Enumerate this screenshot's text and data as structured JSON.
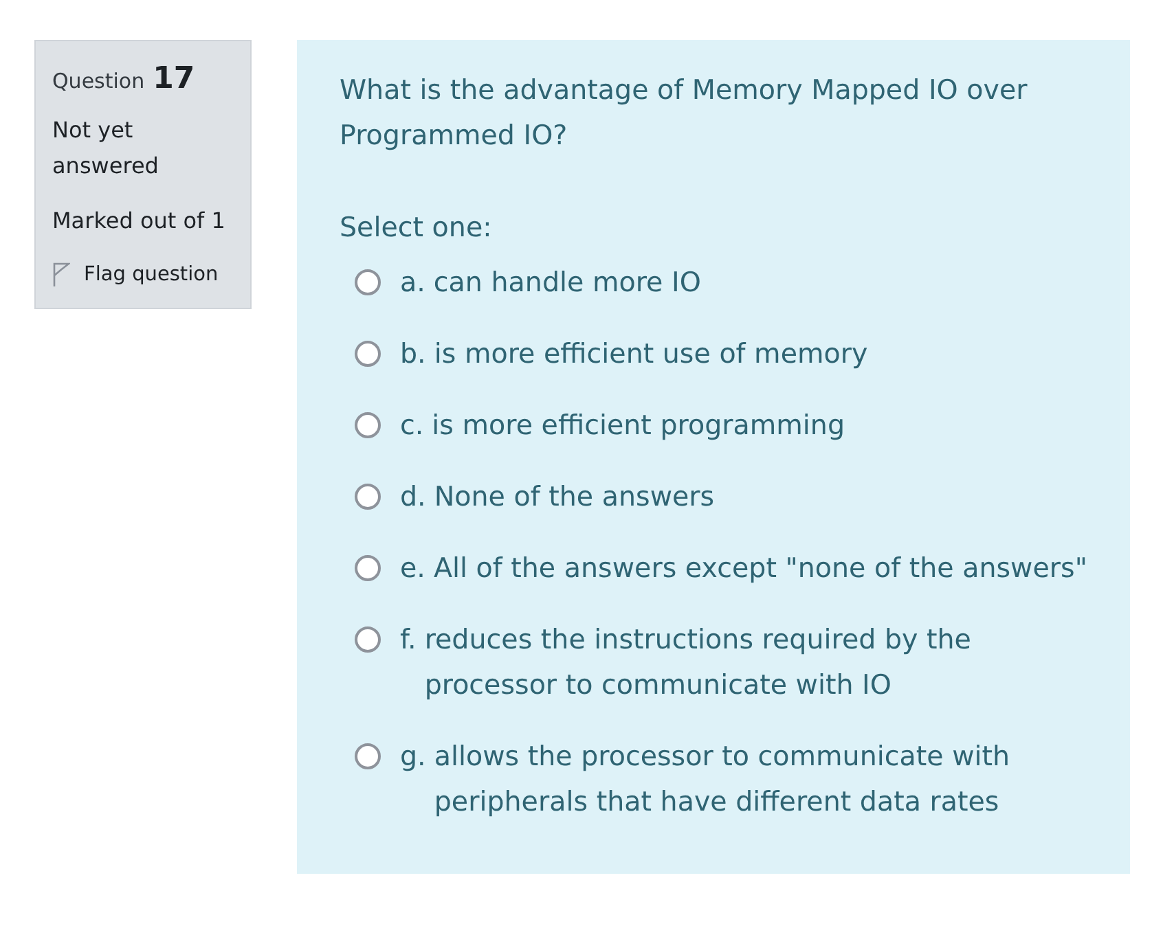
{
  "info": {
    "label": "Question",
    "number": "17",
    "state": "Not yet answered",
    "grade": "Marked out of 1",
    "flag": {
      "label": "Flag question",
      "flagged": false
    }
  },
  "question": {
    "text": "What is the advantage of Memory Mapped IO over Programmed IO?",
    "prompt": "Select one:",
    "options": [
      {
        "letter": "a.",
        "text": "can handle more IO",
        "selected": false
      },
      {
        "letter": "b.",
        "text": "is more efficient use of memory",
        "selected": false
      },
      {
        "letter": "c.",
        "text": "is more efficient programming",
        "selected": false
      },
      {
        "letter": "d.",
        "text": "None of the answers",
        "selected": false
      },
      {
        "letter": "e.",
        "text": "All of the answers except \"none of the answers\"",
        "selected": false
      },
      {
        "letter": "f.",
        "text": "reduces the instructions required by the processor to communicate with IO",
        "selected": false
      },
      {
        "letter": "g.",
        "text": "allows the processor to communicate with peripherals that have different data rates",
        "selected": false
      }
    ]
  }
}
